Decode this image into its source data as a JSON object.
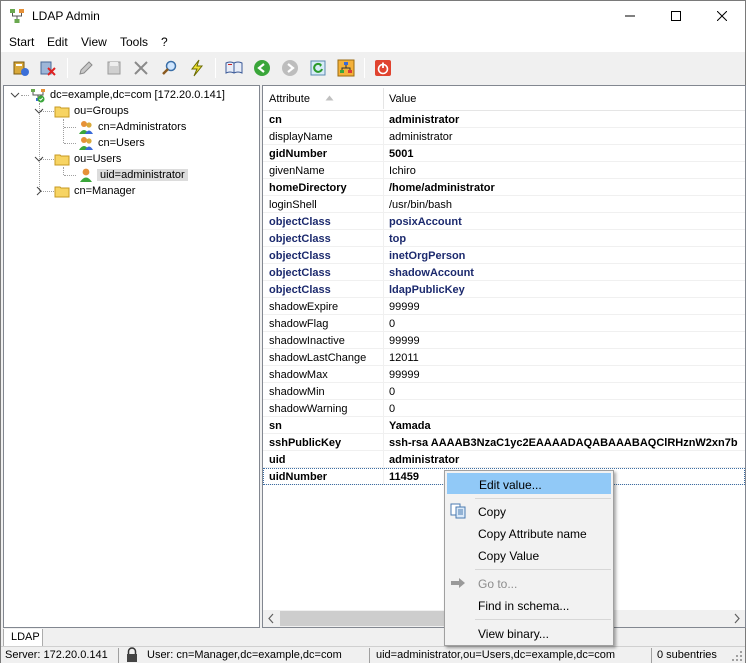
{
  "window": {
    "title": "LDAP Admin"
  },
  "menu": [
    "Start",
    "Edit",
    "View",
    "Tools",
    "?"
  ],
  "tree": {
    "root": "dc=example,dc=com [172.20.0.141]",
    "groups": "ou=Groups",
    "administrators": "cn=Administrators",
    "users_group": "cn=Users",
    "users_ou": "ou=Users",
    "admin_user": "uid=administrator",
    "manager": "cn=Manager"
  },
  "list": {
    "headers": {
      "attribute": "Attribute",
      "value": "Value"
    },
    "rows": [
      {
        "attr": "cn",
        "value": "administrator",
        "style": "b"
      },
      {
        "attr": "displayName",
        "value": "administrator",
        "style": ""
      },
      {
        "attr": "gidNumber",
        "value": "5001",
        "style": "b"
      },
      {
        "attr": "givenName",
        "value": "Ichiro",
        "style": ""
      },
      {
        "attr": "homeDirectory",
        "value": "/home/administrator",
        "style": "b"
      },
      {
        "attr": "loginShell",
        "value": "/usr/bin/bash",
        "style": ""
      },
      {
        "attr": "objectClass",
        "value": "posixAccount",
        "style": "oc"
      },
      {
        "attr": "objectClass",
        "value": "top",
        "style": "oc"
      },
      {
        "attr": "objectClass",
        "value": "inetOrgPerson",
        "style": "oc"
      },
      {
        "attr": "objectClass",
        "value": "shadowAccount",
        "style": "oc"
      },
      {
        "attr": "objectClass",
        "value": "ldapPublicKey",
        "style": "oc"
      },
      {
        "attr": "shadowExpire",
        "value": "99999",
        "style": ""
      },
      {
        "attr": "shadowFlag",
        "value": "0",
        "style": ""
      },
      {
        "attr": "shadowInactive",
        "value": "99999",
        "style": ""
      },
      {
        "attr": "shadowLastChange",
        "value": "12011",
        "style": ""
      },
      {
        "attr": "shadowMax",
        "value": "99999",
        "style": ""
      },
      {
        "attr": "shadowMin",
        "value": "0",
        "style": ""
      },
      {
        "attr": "shadowWarning",
        "value": "0",
        "style": ""
      },
      {
        "attr": "sn",
        "value": "Yamada",
        "style": "b"
      },
      {
        "attr": "sshPublicKey",
        "value": "ssh-rsa AAAAB3NzaC1yc2EAAAADAQABAAABAQClRHznW2xn7b",
        "style": "b"
      },
      {
        "attr": "uid",
        "value": "administrator",
        "style": "b"
      },
      {
        "attr": "uidNumber",
        "value": "11459",
        "style": "b selrow"
      }
    ]
  },
  "context_menu": {
    "edit_value": "Edit value...",
    "copy": "Copy",
    "copy_attr": "Copy Attribute name",
    "copy_value": "Copy Value",
    "goto": "Go to...",
    "find_schema": "Find in schema...",
    "view_binary": "View binary..."
  },
  "tab": "LDAP",
  "status": {
    "server": "Server: 172.20.0.141",
    "user": "User: cn=Manager,dc=example,dc=com",
    "dn": "uid=administrator,ou=Users,dc=example,dc=com",
    "subentries": "0 subentries"
  },
  "colors": {
    "highlight": "#91c9f7",
    "objectclass_text": "#1c2a6e"
  }
}
